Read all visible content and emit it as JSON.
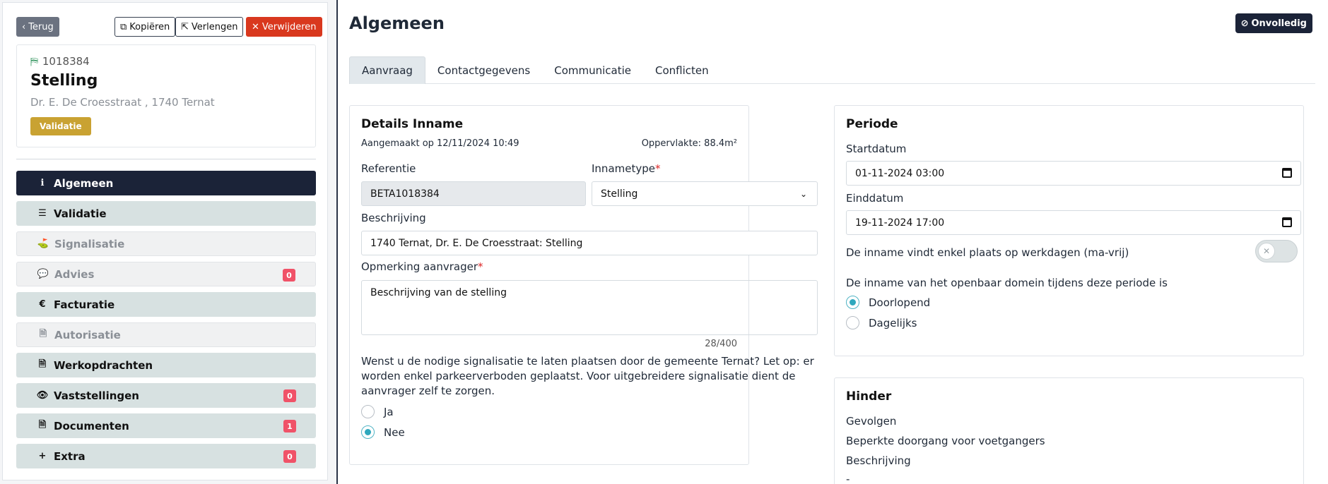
{
  "toolbar": {
    "back_label": "Terug",
    "copy_label": "Kopiëren",
    "extend_label": "Verlengen",
    "delete_label": "Verwijderen"
  },
  "record": {
    "number": "1018384",
    "type": "Stelling",
    "address": "Dr. E. De Croesstraat , 1740 Ternat",
    "badge": "Validatie"
  },
  "menu": [
    {
      "label": "Algemeen",
      "icon": "info-icon",
      "glyph": "ℹ",
      "state": "active",
      "count": ""
    },
    {
      "label": "Validatie",
      "icon": "checklist-icon",
      "glyph": "☰",
      "state": "normal",
      "count": ""
    },
    {
      "label": "Signalisatie",
      "icon": "signpost-icon",
      "glyph": "⛳",
      "state": "disabled",
      "count": ""
    },
    {
      "label": "Advies",
      "icon": "chat-icon",
      "glyph": "💬",
      "state": "disabled",
      "count": "0"
    },
    {
      "label": "Facturatie",
      "icon": "euro-icon",
      "glyph": "€",
      "state": "normal",
      "count": ""
    },
    {
      "label": "Autorisatie",
      "icon": "file-lock-icon",
      "glyph": "🗎",
      "state": "disabled",
      "count": ""
    },
    {
      "label": "Werkopdrachten",
      "icon": "document-icon",
      "glyph": "🗎",
      "state": "normal",
      "count": ""
    },
    {
      "label": "Vaststellingen",
      "icon": "eye-icon",
      "glyph": "👁",
      "state": "normal",
      "count": "0"
    },
    {
      "label": "Documenten",
      "icon": "file-icon",
      "glyph": "🗎",
      "state": "normal",
      "count": "1"
    },
    {
      "label": "Extra",
      "icon": "plus-icon",
      "glyph": "+",
      "state": "normal",
      "count": "0"
    }
  ],
  "main": {
    "title": "Algemeen",
    "status": "Onvolledig",
    "tabs": [
      "Aanvraag",
      "Contactgegevens",
      "Communicatie",
      "Conflicten"
    ]
  },
  "details": {
    "heading": "Details Inname",
    "created": "Aangemaakt op 12/11/2024 10:49",
    "area": "Oppervlakte: 88.4m²",
    "reference_label": "Referentie",
    "reference_value": "BETA1018384",
    "type_label": "Innametype",
    "type_value": "Stelling",
    "description_label": "Beschrijving",
    "description_value": "1740 Ternat, Dr. E. De Croesstraat: Stelling",
    "remark_label": "Opmerking aanvrager",
    "remark_value": "Beschrijving van de stelling",
    "char_count": "28/400",
    "question": "Wenst u de nodige signalisatie te laten plaatsen door de gemeente Ternat? Let op: er worden enkel parkeerverboden geplaatst. Voor uitgebreidere signalisatie dient de aanvrager zelf te zorgen.",
    "option_yes": "Ja",
    "option_no": "Nee",
    "selected": "Nee"
  },
  "period": {
    "heading": "Periode",
    "start_label": "Startdatum",
    "start_value": "01-11-2024 03:00",
    "end_label": "Einddatum",
    "end_value": "19-11-2024 17:00",
    "workdays_label": "De inname vindt enkel plaats op werkdagen (ma-vrij)",
    "workdays_on": false,
    "domain_label": "De inname van het openbaar domein tijdens deze periode is",
    "option_continuous": "Doorlopend",
    "option_daily": "Dagelijks",
    "selected": "Doorlopend"
  },
  "hinder": {
    "heading": "Hinder",
    "consequences_label": "Gevolgen",
    "consequences_value": "Beperkte doorgang voor voetgangers",
    "description_label": "Beschrijving",
    "description_value": "-"
  }
}
